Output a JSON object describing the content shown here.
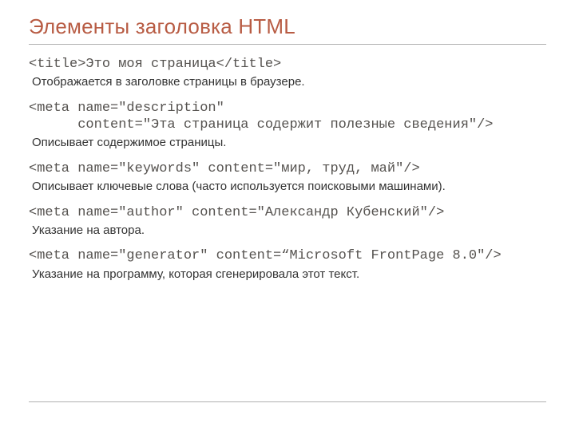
{
  "title": "Элементы заголовка HTML",
  "items": [
    {
      "code": "<title>Это моя страница</title>",
      "desc": "Отображается в заголовке страницы в браузере."
    },
    {
      "code": "<meta name=\"description\"\n      content=\"Эта страница содержит полезные сведения\"/>",
      "desc": "Описывает содержимое страницы."
    },
    {
      "code": "<meta name=\"keywords\" content=\"мир, труд, май\"/>",
      "desc": "Описывает ключевые слова (часто используется поисковыми машинами)."
    },
    {
      "code": "<meta name=\"author\" content=\"Александр Кубенский\"/>",
      "desc": "Указание на автора."
    },
    {
      "code": "<meta name=\"generator\" content=“Microsoft FrontPage 8.0\"/>",
      "desc": "Указание на программу, которая сгенерировала этот текст."
    }
  ]
}
